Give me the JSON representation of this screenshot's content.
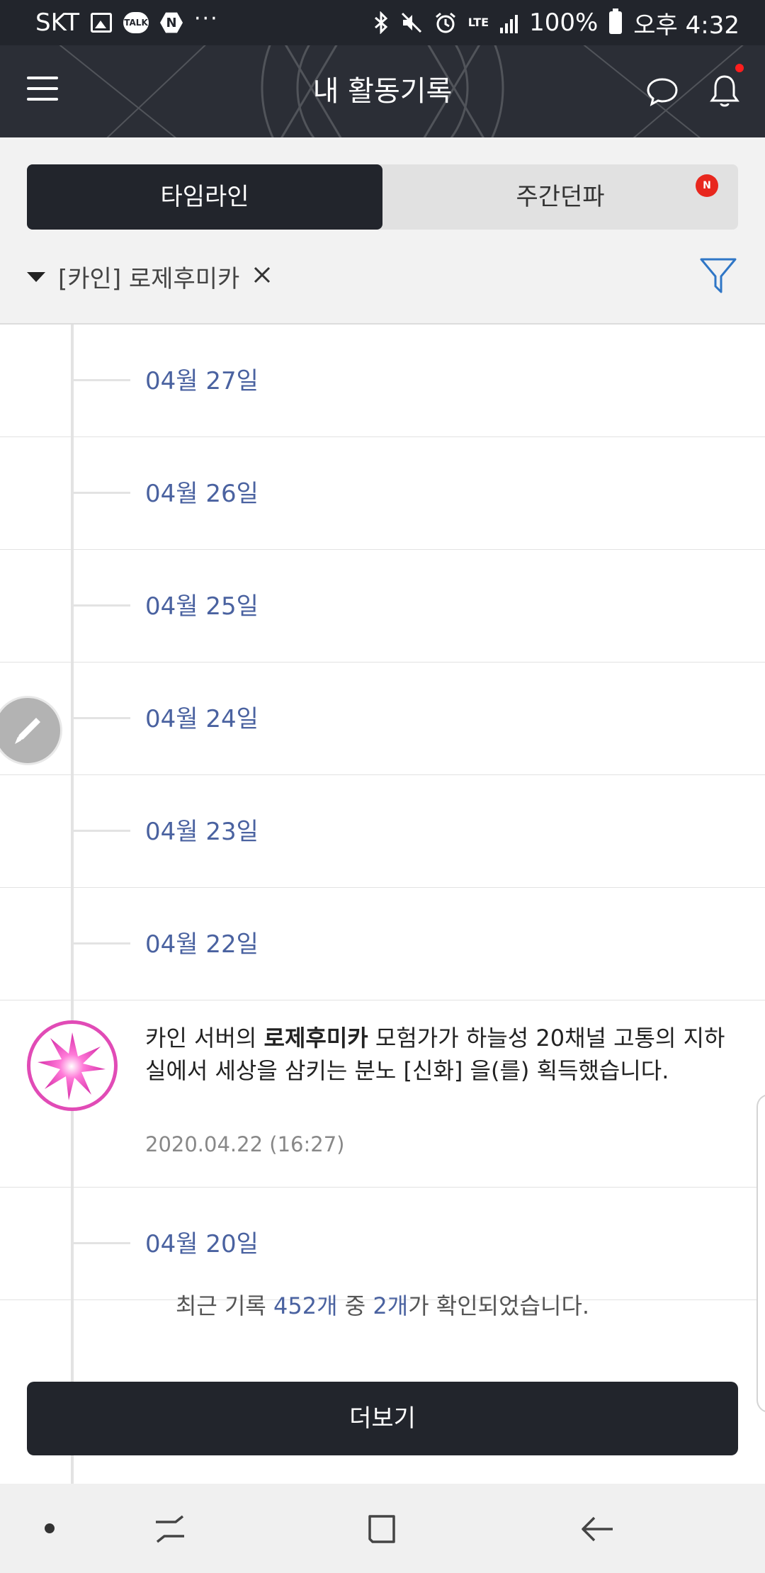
{
  "status_bar": {
    "carrier": "SKT",
    "talk_badge": "TALK",
    "n_badge": "N",
    "more": "···",
    "network": "LTE",
    "battery": "100%",
    "time": "오후 4:32"
  },
  "header": {
    "title": "내 활동기록",
    "has_notification_dot": true
  },
  "tabs": [
    {
      "label": "타임라인",
      "active": true
    },
    {
      "label": "주간던파",
      "active": false,
      "badge": "N"
    }
  ],
  "filter": {
    "label": "[카인] 로제후미카"
  },
  "timeline": {
    "dates": [
      {
        "label": "04월 27일"
      },
      {
        "label": "04월 26일"
      },
      {
        "label": "04월 25일"
      },
      {
        "label": "04월 24일"
      },
      {
        "label": "04월 23일"
      },
      {
        "label": "04월 22일"
      }
    ],
    "event": {
      "server": "카인 서버의 ",
      "character": "로제후미카",
      "message": " 모험가가 하늘성 20채널 고통의 지하실에서 세상을 삼키는 분노 [신화] 을(를) 획득했습니다.",
      "timestamp": "2020.04.22 (16:27)"
    },
    "last_date": {
      "label": "04월 20일"
    }
  },
  "summary": {
    "prefix": "최근 기록 ",
    "total": "452개",
    "middle": " 중 ",
    "shown": "2개",
    "suffix": "가 확인되었습니다."
  },
  "more_button": "더보기",
  "colors": {
    "header_bg": "#2b2e36",
    "accent_blue": "#4a62a0",
    "dark_button": "#22252c",
    "badge_red": "#e8271e",
    "event_pink": "#e14bb6"
  }
}
